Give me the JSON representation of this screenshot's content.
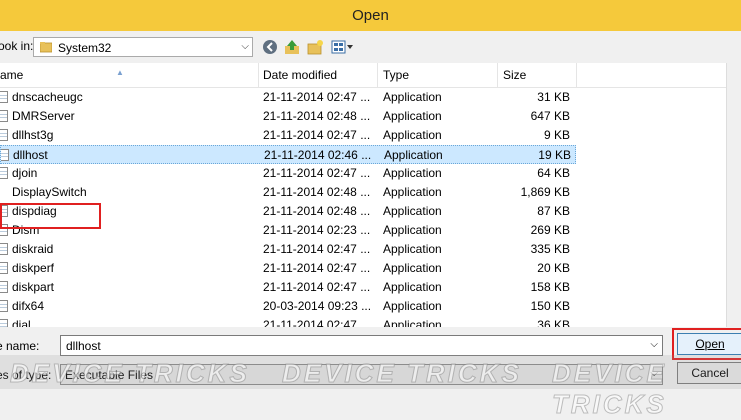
{
  "window": {
    "title": "Open",
    "title_bar_color": "#f5c93b"
  },
  "lookin": {
    "label": "ook in:",
    "value": "System32"
  },
  "toolbar": {
    "icons": [
      "back-icon",
      "up-folder-icon",
      "new-folder-icon",
      "view-menu-icon"
    ]
  },
  "columns": {
    "name": "ame",
    "date": "Date modified",
    "type": "Type",
    "size": "Size"
  },
  "files": [
    {
      "name": "dnscacheugc",
      "date": "21-11-2014 02:47 ...",
      "type": "Application",
      "size": "31 KB"
    },
    {
      "name": "DMRServer",
      "date": "21-11-2014 02:48 ...",
      "type": "Application",
      "size": "647 KB"
    },
    {
      "name": "dllhst3g",
      "date": "21-11-2014 02:47 ...",
      "type": "Application",
      "size": "9 KB"
    },
    {
      "name": "dllhost",
      "date": "21-11-2014 02:46 ...",
      "type": "Application",
      "size": "19 KB",
      "selected": true
    },
    {
      "name": "djoin",
      "date": "21-11-2014 02:47 ...",
      "type": "Application",
      "size": "64 KB"
    },
    {
      "name": "DisplaySwitch",
      "date": "21-11-2014 02:48 ...",
      "type": "Application",
      "size": "1,869 KB"
    },
    {
      "name": "dispdiag",
      "date": "21-11-2014 02:48 ...",
      "type": "Application",
      "size": "87 KB"
    },
    {
      "name": "Dism",
      "date": "21-11-2014 02:23 ...",
      "type": "Application",
      "size": "269 KB"
    },
    {
      "name": "diskraid",
      "date": "21-11-2014 02:47 ...",
      "type": "Application",
      "size": "335 KB"
    },
    {
      "name": "diskperf",
      "date": "21-11-2014 02:47 ...",
      "type": "Application",
      "size": "20 KB"
    },
    {
      "name": "diskpart",
      "date": "21-11-2014 02:47 ...",
      "type": "Application",
      "size": "158 KB"
    },
    {
      "name": "difx64",
      "date": "20-03-2014 09:23 ...",
      "type": "Application",
      "size": "150 KB"
    },
    {
      "name": "dial",
      "date": "21-11-2014 02:47 ...",
      "type": "Application",
      "size": "36 KB"
    }
  ],
  "filename": {
    "label": "e name:",
    "value": "dllhost"
  },
  "filetype": {
    "label": "es of type:",
    "value": "Executable Files"
  },
  "buttons": {
    "open": "Open",
    "cancel": "Cancel"
  },
  "watermark": {
    "text": "DEVICE TRICKS"
  },
  "highlight_color": "#e02020"
}
